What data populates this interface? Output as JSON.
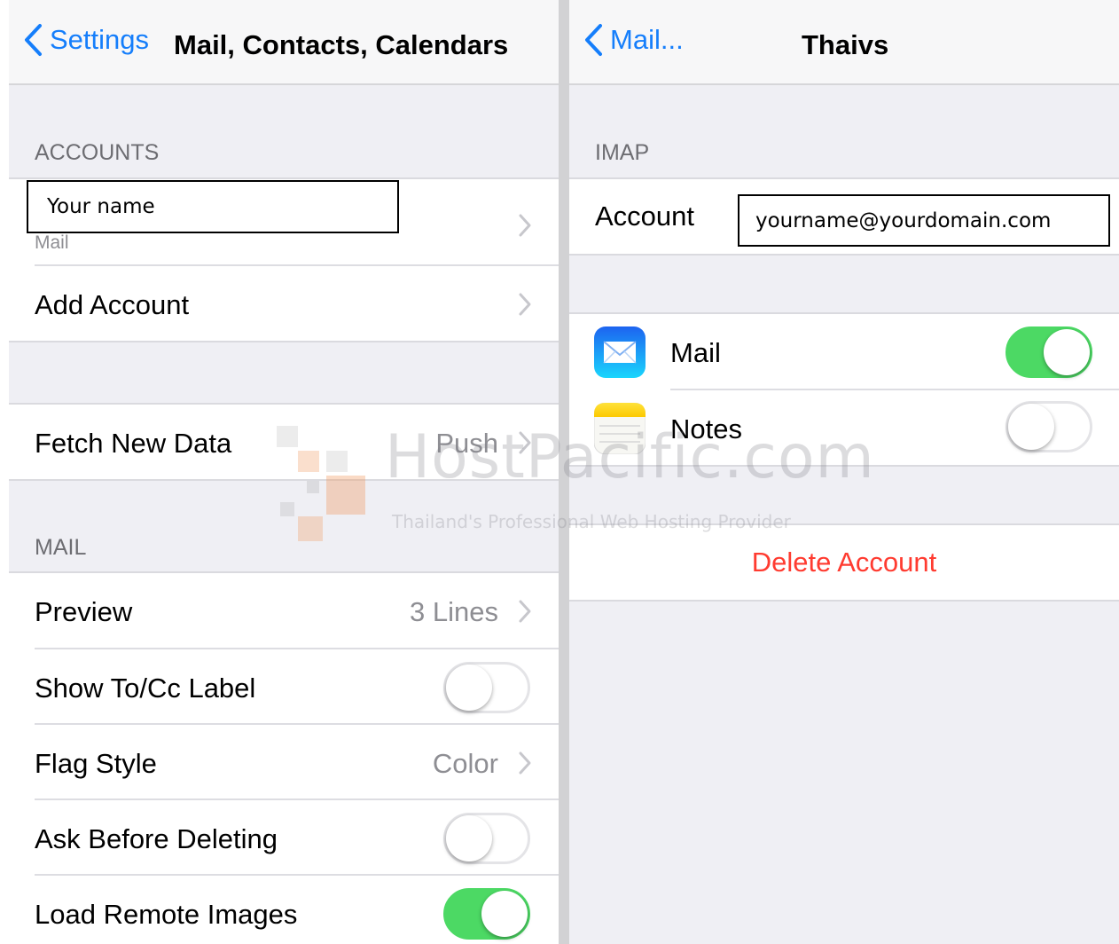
{
  "left": {
    "back_label": "Settings",
    "title": "Mail, Contacts, Calendars",
    "accounts_header": "ACCOUNTS",
    "account_name_box": "Your name",
    "account_sublabel": "Mail",
    "add_account": "Add Account",
    "fetch_new_data": {
      "label": "Fetch New Data",
      "value": "Push"
    },
    "mail_header": "MAIL",
    "preview": {
      "label": "Preview",
      "value": "3 Lines"
    },
    "show_tocc": {
      "label": "Show To/Cc Label",
      "on": false
    },
    "flag_style": {
      "label": "Flag Style",
      "value": "Color"
    },
    "ask_before_deleting": {
      "label": "Ask Before Deleting",
      "on": false
    },
    "load_remote_images": {
      "label": "Load Remote Images",
      "on": true
    }
  },
  "right": {
    "back_label": "Mail...",
    "title": "Thaivs",
    "imap_header": "IMAP",
    "account_label": "Account",
    "account_value_box": "yourname@yourdomain.com",
    "mail_toggle": {
      "label": "Mail",
      "icon": "mail-app-icon",
      "on": true
    },
    "notes_toggle": {
      "label": "Notes",
      "icon": "notes-app-icon",
      "on": false
    },
    "delete_account": "Delete Account"
  },
  "watermark": {
    "name": "HostPacific.com",
    "tagline": "Thailand's Professional Web Hosting Provider"
  },
  "colors": {
    "ios_blue": "#157efb",
    "toggle_green": "#4cd964",
    "destructive_red": "#ff3b30",
    "group_background": "#efeff4"
  }
}
